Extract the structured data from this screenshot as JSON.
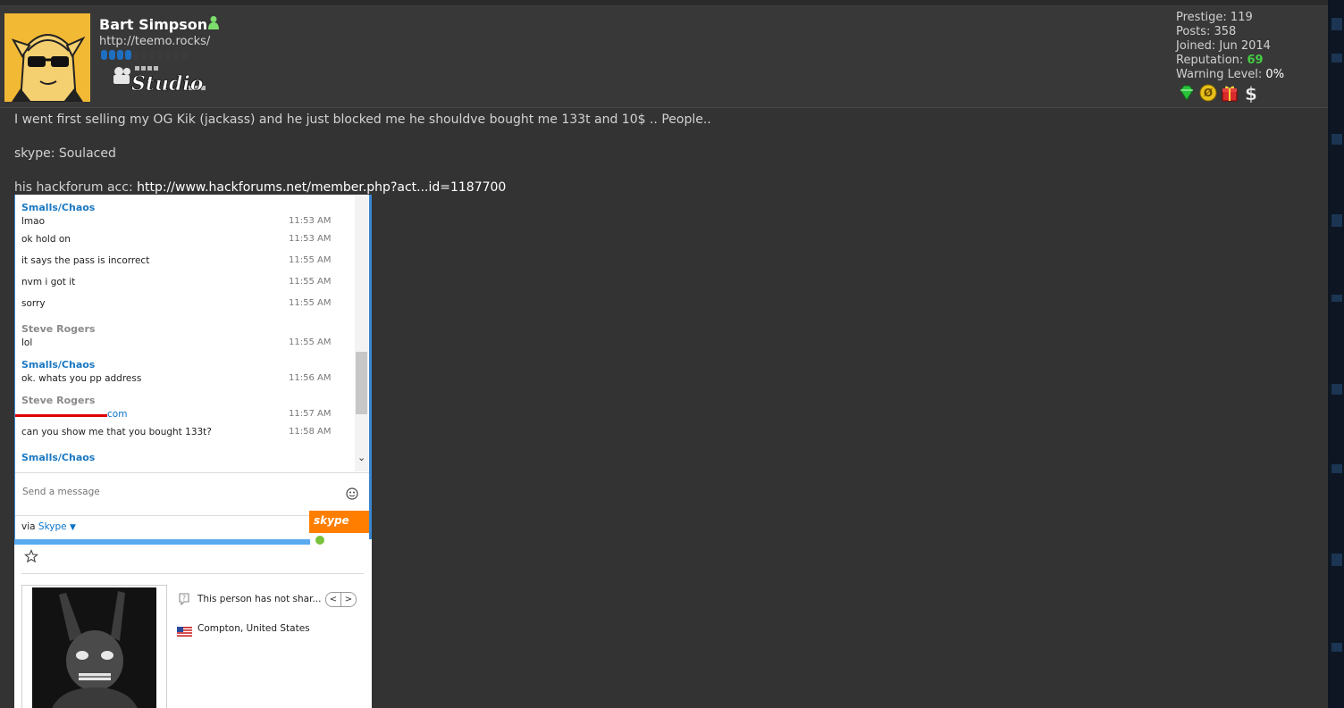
{
  "post": {
    "author": {
      "name": "Bart Simpson",
      "website": "http://teemo.rocks/",
      "userbar_text": "Studio",
      "reputation_dots_filled": 4,
      "reputation_dots_total": 11
    },
    "stats": {
      "prestige_label": "Prestige:",
      "prestige": "119",
      "posts_label": "Posts:",
      "posts": "358",
      "joined_label": "Joined:",
      "joined": "Jun 2014",
      "reputation_label": "Reputation:",
      "reputation": "69",
      "warning_label": "Warning Level:",
      "warning": "0%"
    },
    "awards": [
      "green-gem-icon",
      "gold-coin-icon",
      "gift-icon",
      "dollar-icon"
    ],
    "body": {
      "line1": "I went first selling my OG Kik (jackass) and he just blocked me he shouldve bought me 133t and 10$ .. People..",
      "line2": "skype: Soulaced",
      "line3_prefix": "his hackforum acc: ",
      "line3_link": "http://www.hackforums.net/member.php?act...id=1187700"
    }
  },
  "skype": {
    "chat": [
      {
        "sender": "Smalls/Chaos",
        "text": "lmao",
        "time": "11:53 AM"
      },
      {
        "sender": "",
        "text": "ok hold on",
        "time": "11:53 AM"
      },
      {
        "sender": "",
        "text": "it says the pass is incorrect",
        "time": "11:55 AM"
      },
      {
        "sender": "",
        "text": "nvm i got it",
        "time": "11:55 AM"
      },
      {
        "sender": "",
        "text": "sorry",
        "time": "11:55 AM"
      },
      {
        "sender": "Steve Rogers",
        "text": "lol",
        "time": "11:55 AM"
      },
      {
        "sender": "Smalls/Chaos",
        "text": "ok. whats you pp address",
        "time": "11:56 AM"
      },
      {
        "sender": "Steve Rogers",
        "text": "com",
        "time": "11:57 AM"
      },
      {
        "sender": "",
        "text": "can you show me that you bought 133t?",
        "time": "11:58 AM"
      },
      {
        "sender": "Smalls/Chaos",
        "text": "",
        "time": ""
      }
    ],
    "colors": {
      "smalls": "#1a78c2",
      "steve": "#8a8a8a"
    },
    "composer_placeholder": "Send a message",
    "via_label": "via",
    "via_link": "Skype",
    "logo_text": "skype",
    "profile": {
      "mood": "This person has not shar...",
      "location": "Compton, United States"
    }
  }
}
